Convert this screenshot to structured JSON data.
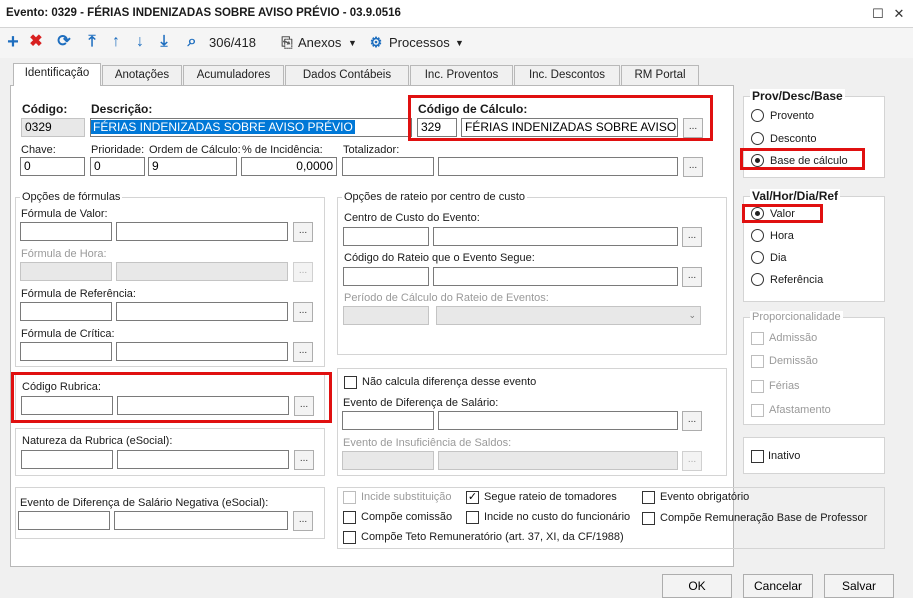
{
  "window": {
    "title": "Evento: 0329 - FÉRIAS INDENIZADAS SOBRE AVISO PRÉVIO - 03.9.0516"
  },
  "toolbar": {
    "record_counter": "306/418",
    "anexos_label": "Anexos",
    "processos_label": "Processos"
  },
  "tabs": [
    "Identificação",
    "Anotações",
    "Acumuladores",
    "Dados Contábeis",
    "Inc. Proventos",
    "Inc. Descontos",
    "RM Portal"
  ],
  "fields": {
    "codigo_label": "Código:",
    "codigo_value": "0329",
    "descricao_label": "Descrição:",
    "descricao_value": "FÉRIAS INDENIZADAS SOBRE AVISO PRÉVIO",
    "codigo_calculo_label": "Código de Cálculo:",
    "codigo_calculo_value": "329",
    "codigo_calculo_desc": "FÉRIAS INDENIZADAS SOBRE AVISO PRÉ",
    "chave_label": "Chave:",
    "chave_value": "0",
    "prioridade_label": "Prioridade:",
    "prioridade_value": "0",
    "ordem_label": "Ordem de Cálculo:",
    "ordem_value": "9",
    "incidencia_label": "% de Incidência:",
    "incidencia_value": "0,0000",
    "totalizador_label": "Totalizador:"
  },
  "formulas": {
    "group_title": "Opções de fórmulas",
    "valor_label": "Fórmula de Valor:",
    "hora_label": "Fórmula de Hora:",
    "referencia_label": "Fórmula de Referência:",
    "critica_label": "Fórmula de Crítica:"
  },
  "rateio": {
    "group_title": "Opções de rateio por centro de custo",
    "centro_label": "Centro de Custo do Evento:",
    "codigo_rateio_label": "Código do Rateio que o Evento Segue:",
    "periodo_label": "Período de Cálculo do Rateio de Eventos:"
  },
  "rubrica": {
    "codigo_label": "Código Rubrica:",
    "natureza_label": "Natureza da Rubrica (eSocial):",
    "diferenca_neg_label": "Evento de Diferença de Salário Negativa (eSocial):"
  },
  "diferenca": {
    "nao_calcula_label": "Não calcula diferença desse evento",
    "evento_diferenca_label": "Evento de Diferença de Salário:",
    "insuficiencia_label": "Evento de Insuficiência de Saldos:"
  },
  "checkboxes": {
    "incide_substituicao": "Incide substituição",
    "segue_rateio": "Segue rateio de tomadores",
    "evento_obrigatorio": "Evento obrigatório",
    "compoe_comissao": "Compõe comissão",
    "incide_custo": "Incide no custo do funcionário",
    "compoe_remuneracao": "Compõe Remuneração Base de Professor",
    "compoe_teto": "Compõe Teto Remuneratório (art. 37, XI, da CF/1988)"
  },
  "prov": {
    "title": "Prov/Desc/Base",
    "provento": "Provento",
    "desconto": "Desconto",
    "base": "Base de cálculo"
  },
  "val": {
    "title": "Val/Hor/Dia/Ref",
    "valor": "Valor",
    "hora": "Hora",
    "dia": "Dia",
    "referencia": "Referência"
  },
  "prop": {
    "title": "Proporcionalidade",
    "admissao": "Admissão",
    "demissao": "Demissão",
    "ferias": "Férias",
    "afastamento": "Afastamento"
  },
  "inativo_label": "Inativo",
  "buttons": {
    "ok": "OK",
    "cancelar": "Cancelar",
    "salvar": "Salvar"
  },
  "colors": {
    "highlight_red": "#e01010",
    "selection_blue": "#0078d7",
    "toolbar_blue": "#1e6ebf",
    "delete_red": "#d82020"
  }
}
